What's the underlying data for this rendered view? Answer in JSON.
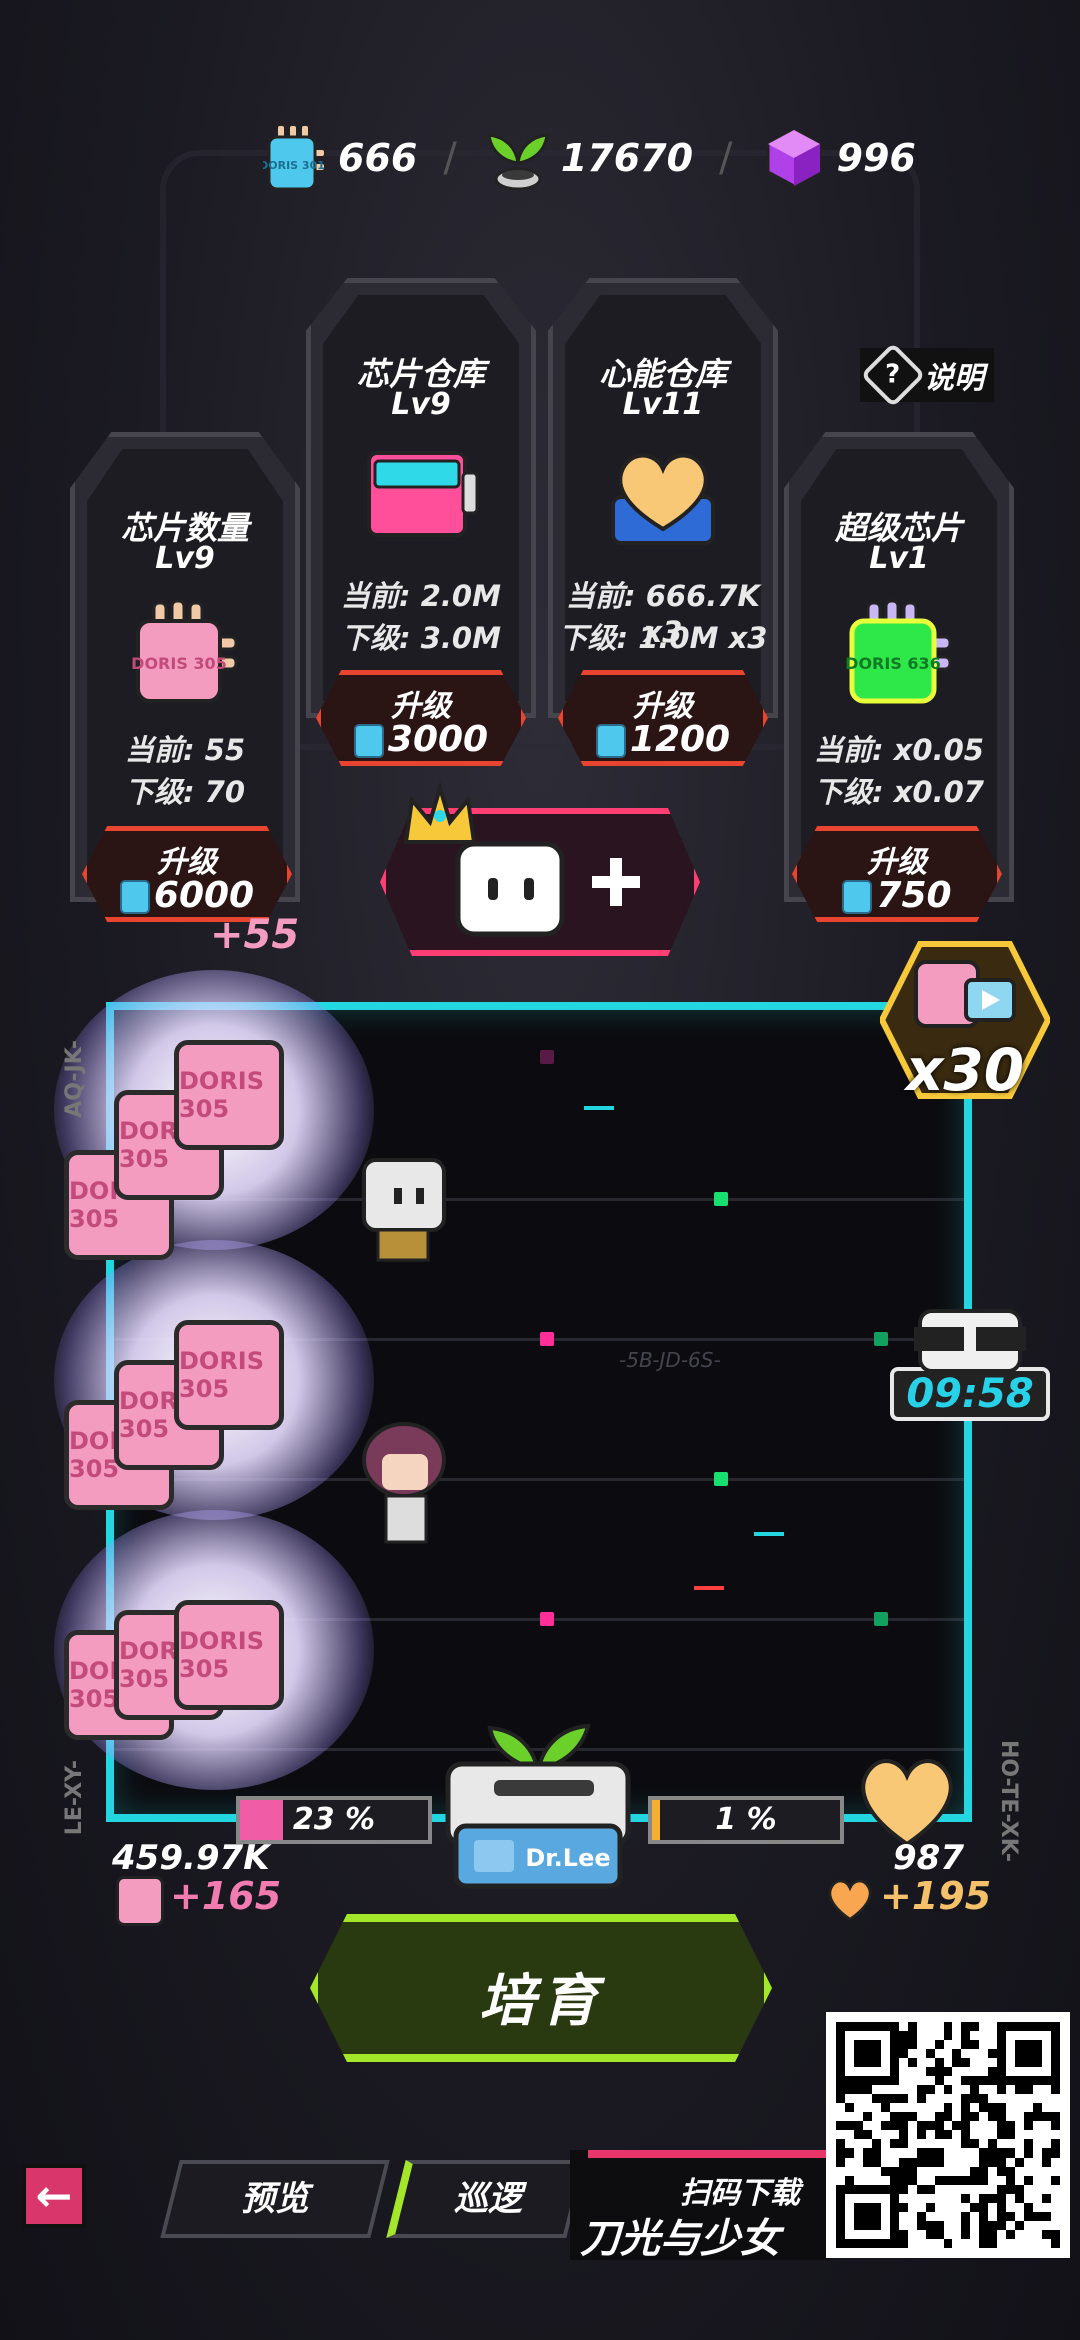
{
  "currencies": [
    {
      "icon": "blue-chip-icon",
      "chip_label": "DORIS 301",
      "value": "666"
    },
    {
      "icon": "sprout-pot-icon",
      "value": "17670"
    },
    {
      "icon": "purple-cube-icon",
      "value": "996"
    }
  ],
  "separator": "/",
  "help": {
    "icon": "question-icon",
    "glyph": "?",
    "label": "说明"
  },
  "cards": [
    {
      "title": "芯片数量",
      "level": "Lv9",
      "current": "当前: 55",
      "next": "下级: 70",
      "button": {
        "label": "升级",
        "cost": "6000"
      },
      "chip_label": "DORIS 305"
    },
    {
      "title": "芯片仓库",
      "level": "Lv9",
      "current": "当前: 2.0M",
      "next": "下级: 3.0M",
      "button": {
        "label": "升级",
        "cost": "3000"
      }
    },
    {
      "title": "心能仓库",
      "level": "Lv11",
      "current": "当前: 666.7K x3",
      "next": "下级: 1.0M x3",
      "button": {
        "label": "升级",
        "cost": "1200"
      }
    },
    {
      "title": "超级芯片",
      "level": "Lv1",
      "current": "当前: x0.05",
      "next": "下级: x0.07",
      "button": {
        "label": "升级",
        "cost": "750"
      },
      "chip_label": "DORIS 636"
    }
  ],
  "arena": {
    "chip_text": "DORIS 305",
    "floating_gain": "+55",
    "center_code": "-5B-JD-6S-",
    "side_code_left": "LE-XY-",
    "side_code_left_top": "AQ-JK-",
    "side_code_right": "HO-TE-XK-",
    "bonus_multiplier": "x30",
    "timer": "09:58"
  },
  "progress": {
    "left_percent": "23 %",
    "left_fill": 0.23,
    "right_percent": "1 %",
    "right_fill": 0.01,
    "machine_label": "Dr.Lee"
  },
  "totals": {
    "chips": "459.97K",
    "chips_gain": "+165",
    "hearts": "987",
    "hearts_gain": "+195"
  },
  "cultivate_label": "培育",
  "nav": {
    "back_glyph": "←",
    "preview": "预览",
    "patrol": "巡逻"
  },
  "promo": {
    "line1": "扫码下载",
    "line2": "刀光与少女"
  },
  "colors": {
    "accent_cyan": "#24d6e0",
    "accent_red": "#e8442f",
    "accent_pink": "#ff3f73",
    "accent_green": "#a4e62a",
    "chip_pink": "#f49bc0"
  }
}
